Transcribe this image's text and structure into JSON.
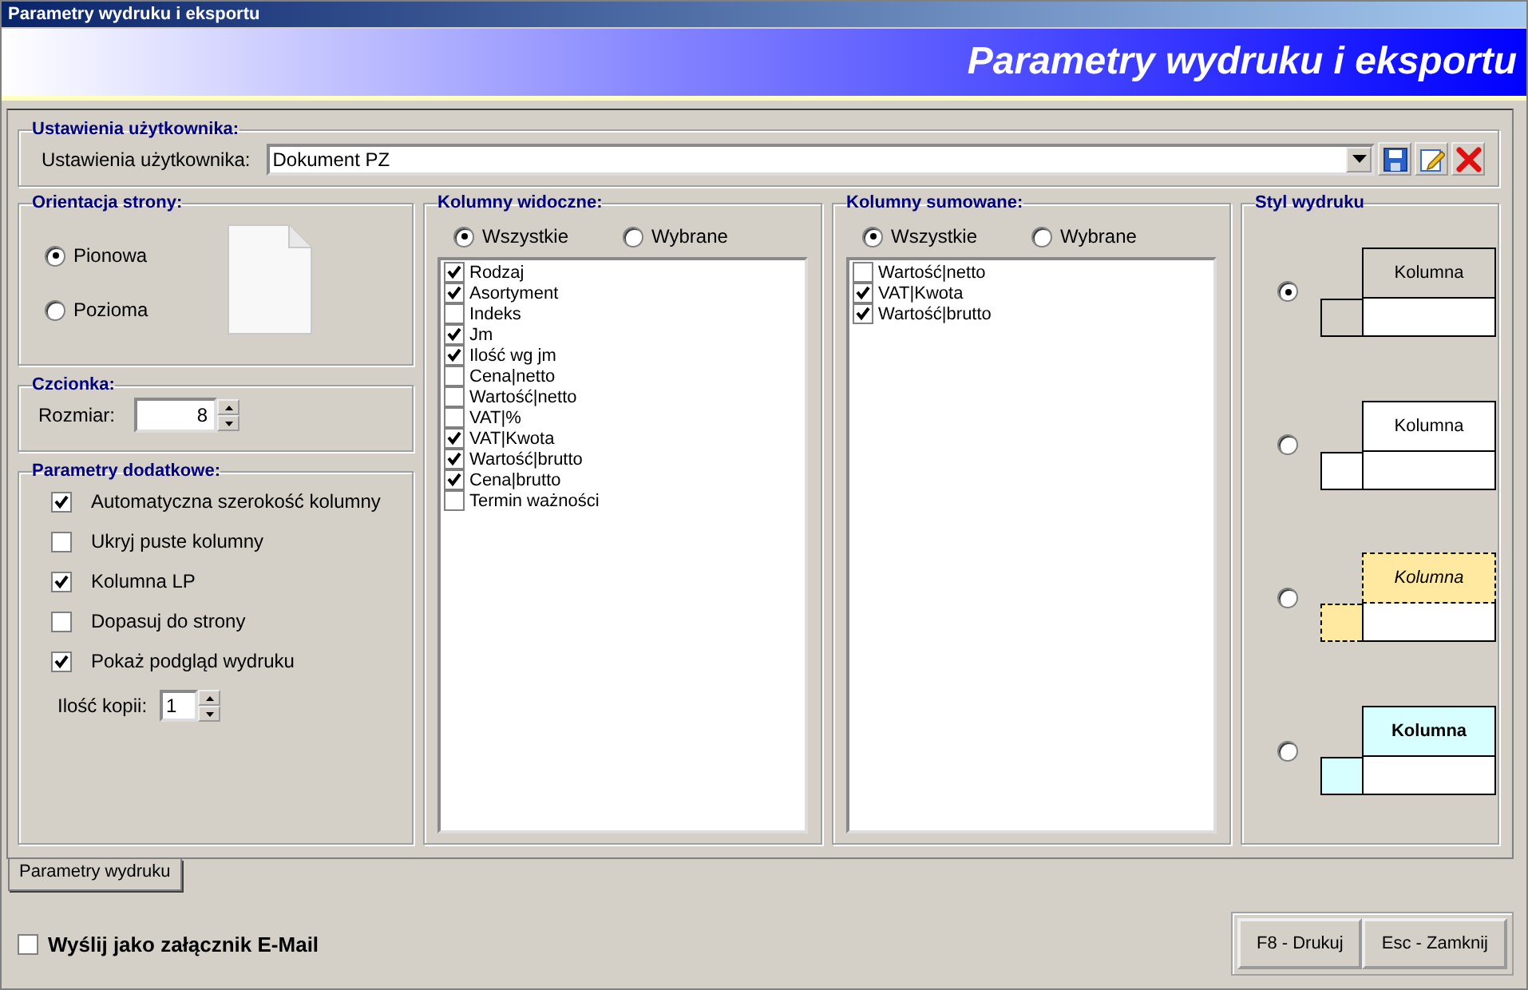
{
  "window": {
    "title": "Parametry wydruku i eksportu"
  },
  "banner": {
    "title": "Parametry wydruku i eksportu"
  },
  "user_settings": {
    "group_title": "Ustawienia użytkownika:",
    "label": "Ustawienia użytkownika:",
    "value": "Dokument PZ"
  },
  "orientation": {
    "group_title": "Orientacja strony:",
    "options": [
      {
        "label": "Pionowa",
        "selected": true
      },
      {
        "label": "Pozioma",
        "selected": false
      }
    ]
  },
  "font": {
    "group_title": "Czcionka:",
    "label": "Rozmiar:",
    "value": "8"
  },
  "extra": {
    "group_title": "Parametry dodatkowe:",
    "options": [
      {
        "label": "Automatyczna szerokość kolumny",
        "checked": true
      },
      {
        "label": "Ukryj puste kolumny",
        "checked": false
      },
      {
        "label": "Kolumna LP",
        "checked": true
      },
      {
        "label": "Dopasuj do strony",
        "checked": false
      },
      {
        "label": "Pokaż podgląd wydruku",
        "checked": true
      }
    ],
    "copies_label": "Ilość kopii:",
    "copies_value": "1"
  },
  "visible_columns": {
    "group_title": "Kolumny widoczne:",
    "modes": [
      {
        "label": "Wszystkie",
        "selected": true
      },
      {
        "label": "Wybrane",
        "selected": false
      }
    ],
    "items": [
      {
        "label": "Rodzaj",
        "checked": true
      },
      {
        "label": "Asortyment",
        "checked": true
      },
      {
        "label": "Indeks",
        "checked": false
      },
      {
        "label": "Jm",
        "checked": true
      },
      {
        "label": "Ilość wg jm",
        "checked": true
      },
      {
        "label": "Cena|netto",
        "checked": false
      },
      {
        "label": "Wartość|netto",
        "checked": false
      },
      {
        "label": "VAT|%",
        "checked": false
      },
      {
        "label": "VAT|Kwota",
        "checked": true
      },
      {
        "label": "Wartość|brutto",
        "checked": true
      },
      {
        "label": "Cena|brutto",
        "checked": true
      },
      {
        "label": "Termin ważności",
        "checked": false
      }
    ]
  },
  "summed_columns": {
    "group_title": "Kolumny sumowane:",
    "modes": [
      {
        "label": "Wszystkie",
        "selected": true
      },
      {
        "label": "Wybrane",
        "selected": false
      }
    ],
    "items": [
      {
        "label": "Wartość|netto",
        "checked": false
      },
      {
        "label": "VAT|Kwota",
        "checked": true
      },
      {
        "label": "Wartość|brutto",
        "checked": true
      }
    ]
  },
  "print_style": {
    "group_title": "Styl wydruku",
    "options": [
      {
        "kind": "classic",
        "label": "Kolumna",
        "selected": true
      },
      {
        "kind": "plain",
        "label": "Kolumna",
        "selected": false
      },
      {
        "kind": "dashed",
        "label": "Kolumna",
        "selected": false
      },
      {
        "kind": "bold",
        "label": "Kolumna",
        "selected": false
      }
    ]
  },
  "tabs": [
    {
      "label": "Parametry wydruku",
      "selected": true
    }
  ],
  "email": {
    "label": "Wyślij jako załącznik E-Mail",
    "checked": false
  },
  "buttons": [
    "F8 - Drukuj",
    "Esc - Zamknij"
  ]
}
